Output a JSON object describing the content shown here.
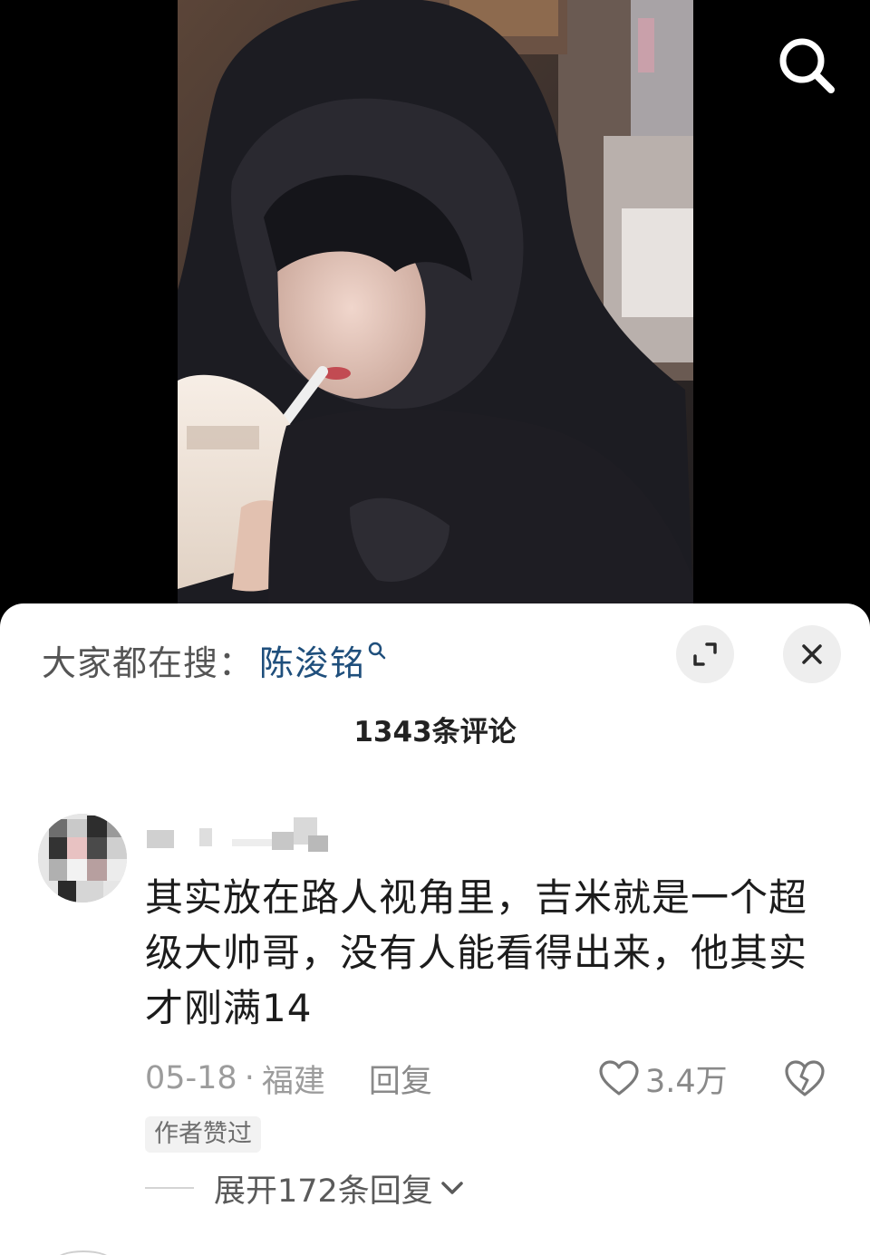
{
  "video": {
    "image": "video-frame",
    "search_icon": "search-icon"
  },
  "trending": {
    "prefix": "大家都在搜：",
    "term": "陈浚铭",
    "icon": "search-small-icon"
  },
  "controls": {
    "expand_icon": "expand-icon",
    "close_icon": "close-icon"
  },
  "comments_header": {
    "title": "1343条评论"
  },
  "comment": {
    "avatar": "avatar (blurred)",
    "text": "其实放在路人视角里，吉米就是一个超级大帅哥，没有人能看得出来，他其实才刚满14",
    "date": "05-18",
    "separator": "·",
    "location": "福建",
    "reply_label": "回复",
    "like_icon": "heart-icon",
    "likes": "3.4万",
    "dislike_icon": "broken-heart-icon",
    "badge": "作者赞过",
    "expand_label": "展开172条回复",
    "expand_icon": "chevron-down-icon"
  }
}
